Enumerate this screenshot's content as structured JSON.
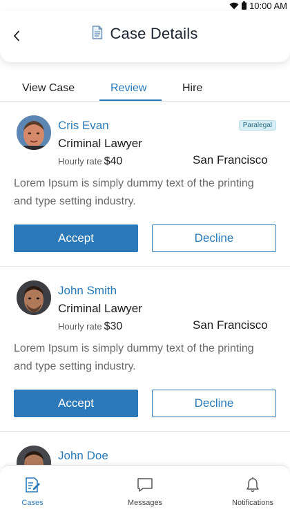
{
  "status_bar": {
    "time": "10:00 AM"
  },
  "header": {
    "title": "Case Details"
  },
  "tabs": [
    {
      "label": "View Case",
      "active": false
    },
    {
      "label": "Review",
      "active": true
    },
    {
      "label": "Hire",
      "active": false
    }
  ],
  "candidates": [
    {
      "name": "Cris Evan",
      "role": "Criminal Lawyer",
      "rate_label": "Hourly rate",
      "rate_value": "$40",
      "location": "San Francisco",
      "badge": "Paralegal",
      "description": "Lorem Ipsum is simply dummy text of the printing and type setting industry.",
      "accept_label": "Accept",
      "decline_label": "Decline"
    },
    {
      "name": "John Smith",
      "role": "Criminal Lawyer",
      "rate_label": "Hourly rate",
      "rate_value": "$30",
      "location": "San Francisco",
      "description": "Lorem Ipsum is simply dummy text of the printing and type setting industry.",
      "accept_label": "Accept",
      "decline_label": "Decline"
    },
    {
      "name": "John Doe"
    }
  ],
  "bottom_nav": [
    {
      "label": "Cases",
      "icon": "cases-icon",
      "active": true
    },
    {
      "label": "Messages",
      "icon": "message-icon",
      "active": false
    },
    {
      "label": "Notifications",
      "icon": "bell-icon",
      "active": false
    }
  ],
  "colors": {
    "accent": "#2b79b9",
    "badge_bg": "#d6eef4",
    "text": "#1f1f1f",
    "muted": "#6a6a6a"
  }
}
